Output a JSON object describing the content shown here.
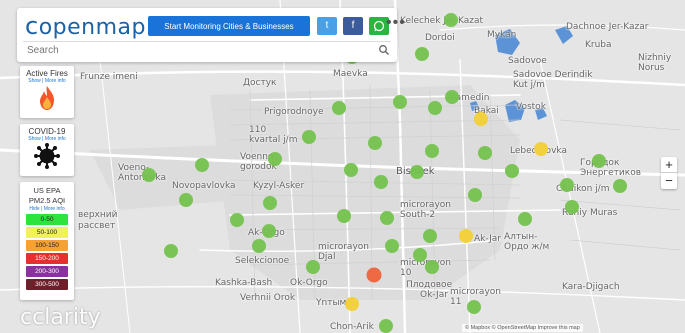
{
  "header": {
    "logo": "openmap",
    "start_button": "Start Monitoring  Cities & Businesses",
    "twitter_label": "t",
    "facebook_label": "f",
    "whatsapp_label": "w",
    "more_label": "•••",
    "search_placeholder": "Search"
  },
  "cards": {
    "fires": {
      "title": "Active Fires",
      "links": "Show | More info"
    },
    "covid": {
      "title": "COVID-19",
      "links": "Show | More info"
    },
    "aqi": {
      "title_line1": "US EPA",
      "title_line2": "PM2.5 AQI",
      "links": "Hide | More info",
      "legend": [
        {
          "label": "0-50",
          "color": "#2ee33e"
        },
        {
          "label": "50-100",
          "color": "#f1f15a"
        },
        {
          "label": "100-150",
          "color": "#f6a133"
        },
        {
          "label": "150-200",
          "color": "#e53030"
        },
        {
          "label": "200-300",
          "color": "#8d2fa0"
        },
        {
          "label": "300-500",
          "color": "#6e1f29"
        }
      ]
    }
  },
  "zoom": {
    "in": "+",
    "out": "−"
  },
  "brand": "clarity",
  "attribution": "© Mapbox © OpenStreetMap  Improve this map",
  "map_labels": [
    "Kelechek Jer Kazat",
    "Dordoi",
    "Mykan",
    "Dachnoe Jer-Kazar",
    "Kruba",
    "Nizhniy Norus",
    "Sadovoe",
    "Sadovoe Derindik Kut j/m",
    "Frunze imeni",
    "Достук",
    "Maevka",
    "Alamedin",
    "Bakai",
    "Vostok",
    "Prigorodnoye",
    "110 kvartal j/m",
    "Voenno-gorodok",
    "Voeno-Antonovka",
    "Novopavlovka",
    "Kyzyl-Asker",
    "Bishkek",
    "Lebedinovka",
    "Городок Энергетиков",
    "Chuikon j/m",
    "microrayon South-2",
    "Ruhiy Muras",
    "Ak-Orgo",
    "Selekcionoe",
    "microrayon Djal",
    "Ak-Jar",
    "Алтын-Ордо ж/м",
    "Kashka-Bash",
    "Ok-Orgo",
    "Verhnii Orok",
    "Ynтымак",
    "Ok-Jar",
    "microrayon 10",
    "microrayon 11",
    "Плодовое",
    "Kara-Djigach",
    "Chon-Arik",
    "верхний",
    "рассвет"
  ]
}
